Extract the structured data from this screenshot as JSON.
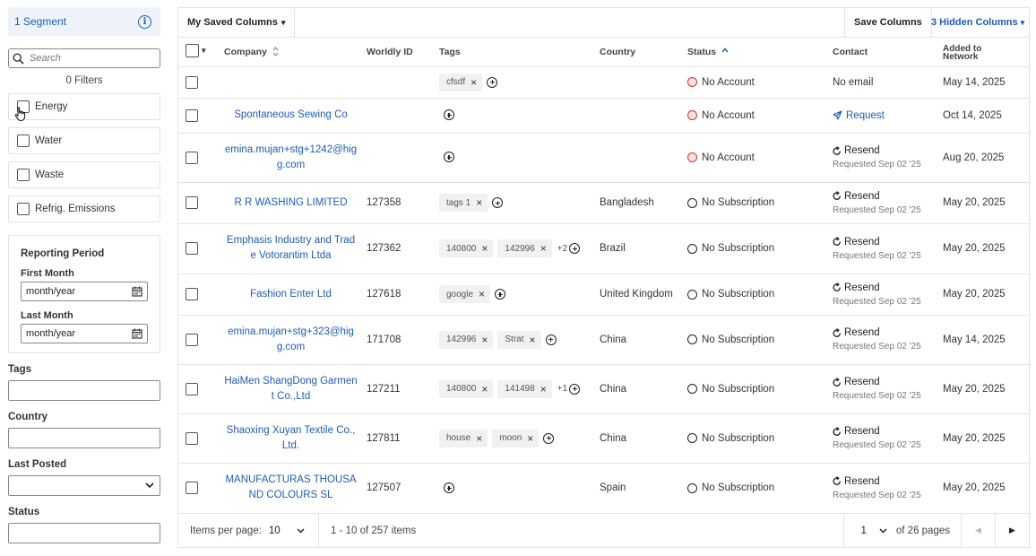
{
  "sidebar": {
    "segment_label": "1 Segment",
    "search_placeholder": "Search",
    "filters_count": "0 Filters",
    "filters": [
      {
        "label": "Energy"
      },
      {
        "label": "Water"
      },
      {
        "label": "Waste"
      },
      {
        "label": "Refrig. Emissions"
      }
    ],
    "reporting_period": {
      "title": "Reporting Period",
      "first_month_label": "First Month",
      "first_month_value": "month/year",
      "last_month_label": "Last Month",
      "last_month_value": "month/year"
    },
    "tags_label": "Tags",
    "country_label": "Country",
    "last_posted_label": "Last Posted",
    "status_label": "Status"
  },
  "toolbar": {
    "saved_columns": "My Saved Columns",
    "save_columns": "Save Columns",
    "hidden_columns": "3 Hidden Columns"
  },
  "table": {
    "headers": {
      "company": "Company",
      "worldly_id": "Worldly ID",
      "tags": "Tags",
      "country": "Country",
      "status": "Status",
      "contact": "Contact",
      "added_1": "Added to",
      "added_2": "Network"
    },
    "rows": [
      {
        "company": "",
        "wid": "",
        "tags": [
          "cfsdf"
        ],
        "more": "",
        "country": "",
        "status": "No Account",
        "status_color": "red",
        "contact": "No email",
        "contact_type": "text",
        "contact_sub": "",
        "added": "May 14, 2025"
      },
      {
        "company": "Spontaneous Sewing Co",
        "wid": "",
        "tags": [],
        "more": "",
        "country": "",
        "status": "No Account",
        "status_color": "red",
        "contact": "Request",
        "contact_type": "request",
        "contact_sub": "",
        "added": "Oct 14, 2025"
      },
      {
        "company": "emina.mujan+stg+1242@higg.com",
        "wid": "",
        "tags": [],
        "more": "",
        "country": "",
        "status": "No Account",
        "status_color": "red",
        "contact": "Resend",
        "contact_type": "resend",
        "contact_sub": "Requested Sep 02 '25",
        "added": "Aug 20, 2025"
      },
      {
        "company": "R R WASHING LIMITED",
        "wid": "127358",
        "tags": [
          "tags 1"
        ],
        "more": "",
        "country": "Bangladesh",
        "status": "No Subscription",
        "status_color": "none",
        "contact": "Resend",
        "contact_type": "resend",
        "contact_sub": "Requested Sep 02 '25",
        "added": "May 20, 2025"
      },
      {
        "company": "Emphasis Industry and Trade Votorantim Ltda",
        "wid": "127362",
        "tags": [
          "140800",
          "142996"
        ],
        "more": "+2",
        "country": "Brazil",
        "status": "No Subscription",
        "status_color": "none",
        "contact": "Resend",
        "contact_type": "resend",
        "contact_sub": "Requested Sep 02 '25",
        "added": "May 20, 2025"
      },
      {
        "company": "Fashion Enter Ltd",
        "wid": "127618",
        "tags": [
          "google"
        ],
        "more": "",
        "country": "United Kingdom",
        "status": "No Subscription",
        "status_color": "none",
        "contact": "Resend",
        "contact_type": "resend",
        "contact_sub": "Requested Sep 02 '25",
        "added": "May 20, 2025"
      },
      {
        "company": "emina.mujan+stg+323@higg.com",
        "wid": "171708",
        "tags": [
          "142996",
          "Strat"
        ],
        "more": "",
        "country": "China",
        "status": "No Subscription",
        "status_color": "none",
        "contact": "Resend",
        "contact_type": "resend",
        "contact_sub": "Requested Sep 02 '25",
        "added": "May 14, 2025"
      },
      {
        "company": "HaiMen ShangDong Garment Co.,Ltd",
        "wid": "127211",
        "tags": [
          "140800",
          "141498"
        ],
        "more": "+1",
        "country": "China",
        "status": "No Subscription",
        "status_color": "none",
        "contact": "Resend",
        "contact_type": "resend",
        "contact_sub": "Requested Sep 02 '25",
        "added": "May 20, 2025"
      },
      {
        "company": "Shaoxing Xuyan Textile Co., Ltd.",
        "wid": "127811",
        "tags": [
          "house",
          "moon"
        ],
        "more": "",
        "country": "China",
        "status": "No Subscription",
        "status_color": "none",
        "contact": "Resend",
        "contact_type": "resend",
        "contact_sub": "Requested Sep 02 '25",
        "added": "May 20, 2025"
      },
      {
        "company": "MANUFACTURAS THOUSAND COLOURS SL",
        "wid": "127507",
        "tags": [],
        "more": "",
        "country": "Spain",
        "status": "No Subscription",
        "status_color": "none",
        "contact": "Resend",
        "contact_type": "resend",
        "contact_sub": "Requested Sep 02 '25",
        "added": "May 20, 2025"
      }
    ]
  },
  "footer": {
    "items_per_page_label": "Items per page:",
    "items_per_page_value": "10",
    "range": "1 - 10 of 257 items",
    "page_value": "1",
    "of_pages": "of 26 pages"
  },
  "colors": {
    "accent": "#1f5bb5",
    "no_account": "#d0302f",
    "segment_bg": "#eef3fb"
  }
}
